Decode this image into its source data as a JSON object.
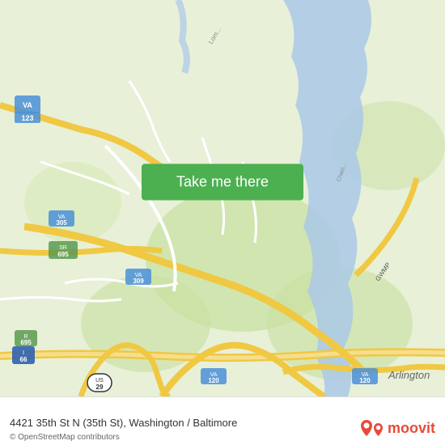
{
  "map": {
    "background_color": "#e8f0d8",
    "water_color": "#a8c8e8",
    "road_color": "#f5d98b",
    "road_minor_color": "#ffffff",
    "park_color": "#c8dfa0"
  },
  "button": {
    "label": "Take me there",
    "bg_color": "#4caf50",
    "text_color": "#ffffff"
  },
  "bottom_bar": {
    "address": "4421 35th St N (35th St), Washington / Baltimore",
    "copyright": "© OpenStreetMap contributors",
    "logo_text": "moovit"
  },
  "pin": {
    "color": "#4caf50",
    "inner_color": "#ffffff"
  }
}
